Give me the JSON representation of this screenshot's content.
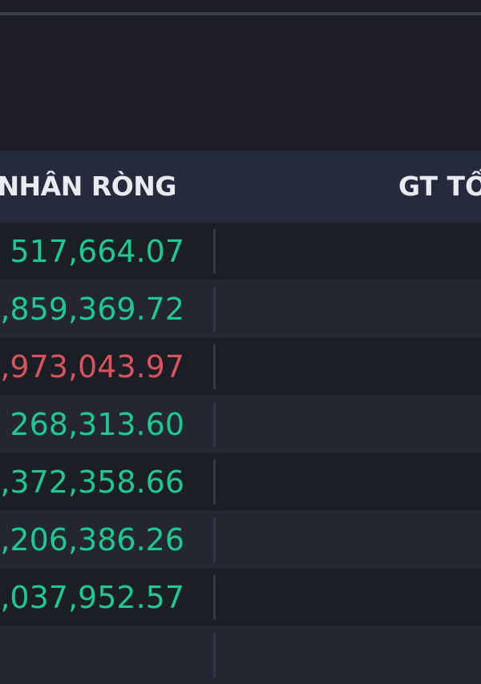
{
  "colors": {
    "background": "#1c1d26",
    "header_bg": "#252a3d",
    "row_odd": "#1c1e26",
    "row_even": "#242731",
    "positive": "#1ec98f",
    "negative": "#d9525c",
    "header_text": "#e9ebf2"
  },
  "table": {
    "columns": [
      {
        "label": "NHÂN RÒNG"
      },
      {
        "label": "GT TỐ"
      }
    ],
    "rows": [
      {
        "value": "517,664.07",
        "trend": "positive"
      },
      {
        "value": ",859,369.72",
        "trend": "positive"
      },
      {
        "value": ",973,043.97",
        "trend": "negative"
      },
      {
        "value": "268,313.60",
        "trend": "positive"
      },
      {
        "value": ",372,358.66",
        "trend": "positive"
      },
      {
        "value": ",206,386.26",
        "trend": "positive"
      },
      {
        "value": ",037,952.57",
        "trend": "positive"
      }
    ]
  }
}
